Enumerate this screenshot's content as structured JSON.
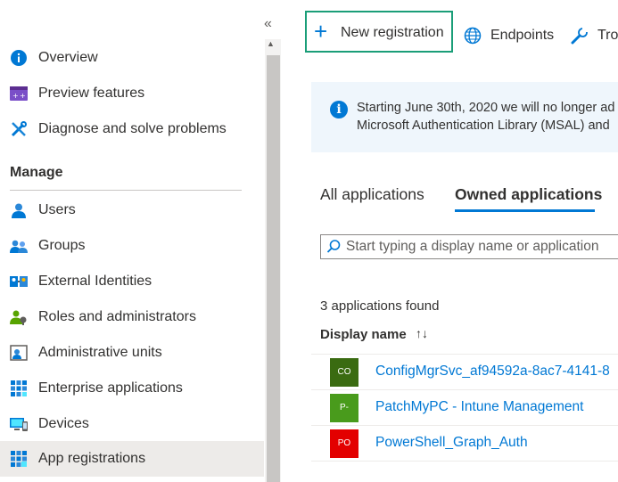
{
  "sidebar": {
    "collapse_glyph": "«",
    "items_top": [
      {
        "label": "Overview",
        "icon": "info-icon"
      },
      {
        "label": "Preview features",
        "icon": "preview-features-icon"
      },
      {
        "label": "Diagnose and solve problems",
        "icon": "tools-icon"
      }
    ],
    "section": "Manage",
    "items_manage": [
      {
        "label": "Users",
        "icon": "user-icon"
      },
      {
        "label": "Groups",
        "icon": "groups-icon"
      },
      {
        "label": "External Identities",
        "icon": "external-identities-icon"
      },
      {
        "label": "Roles and administrators",
        "icon": "roles-icon"
      },
      {
        "label": "Administrative units",
        "icon": "admin-units-icon"
      },
      {
        "label": "Enterprise applications",
        "icon": "enterprise-apps-icon"
      },
      {
        "label": "Devices",
        "icon": "devices-icon"
      },
      {
        "label": "App registrations",
        "icon": "app-registrations-icon",
        "selected": true
      }
    ]
  },
  "toolbar": {
    "new_registration": "New registration",
    "endpoints": "Endpoints",
    "troubleshooting": "Tro"
  },
  "banner": {
    "line1": "Starting June 30th, 2020 we will no longer ad",
    "line2": "Microsoft Authentication Library (MSAL) and"
  },
  "tabs": {
    "all": "All applications",
    "owned": "Owned applications"
  },
  "search": {
    "placeholder": "Start typing a display name or application"
  },
  "results": {
    "count": "3 applications found",
    "column": "Display name",
    "sort_glyph": "↑↓",
    "rows": [
      {
        "initials": "CO",
        "name": "ConfigMgrSvc_af94592a-8ac7-4141-8",
        "color": "#3a6b11"
      },
      {
        "initials": "P-",
        "name": "PatchMyPC - Intune Management",
        "color": "#499b1c"
      },
      {
        "initials": "PO",
        "name": "PowerShell_Graph_Auth",
        "color": "#e30000"
      }
    ]
  },
  "colors": {
    "accent": "#0078d4",
    "highlight_border": "#1a9e78"
  }
}
